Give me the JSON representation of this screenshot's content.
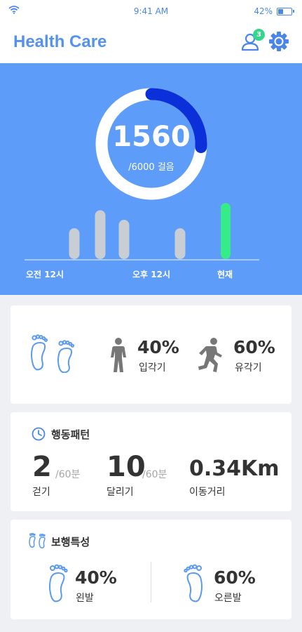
{
  "status_bar": {
    "time": "9:41 AM",
    "battery": "42%",
    "battery_fraction": 0.42
  },
  "header": {
    "title": "Health Care",
    "notification_count": "3"
  },
  "summary": {
    "steps": "1560",
    "goal_text": "/6000 걸음",
    "progress_fraction": 0.26,
    "time_labels": [
      "오전 12시",
      "오후 12시",
      "현재"
    ],
    "activity_levels": [
      0.55,
      0.87,
      0.7,
      0.55,
      1.0
    ],
    "colors": {
      "background": "#5d9cf8",
      "progress_arc": "#0b2fd8",
      "current_bar": "#35ec87",
      "bar": "#c9cdd4"
    }
  },
  "stance": {
    "stand": {
      "percent": "40%",
      "label": "입각기"
    },
    "swing": {
      "percent": "60%",
      "label": "유각기"
    }
  },
  "pattern": {
    "title": "행동패턴",
    "walking": {
      "value": "2",
      "unit": "/60분",
      "label": "걷기"
    },
    "running": {
      "value": "10",
      "unit": "/60분",
      "label": "달리기"
    },
    "distance": {
      "value": "0.34Km",
      "label": "이동거리"
    }
  },
  "gait": {
    "title": "보행특성",
    "left": {
      "percent": "40%",
      "label": "왼발"
    },
    "right": {
      "percent": "60%",
      "label": "오른발"
    }
  }
}
